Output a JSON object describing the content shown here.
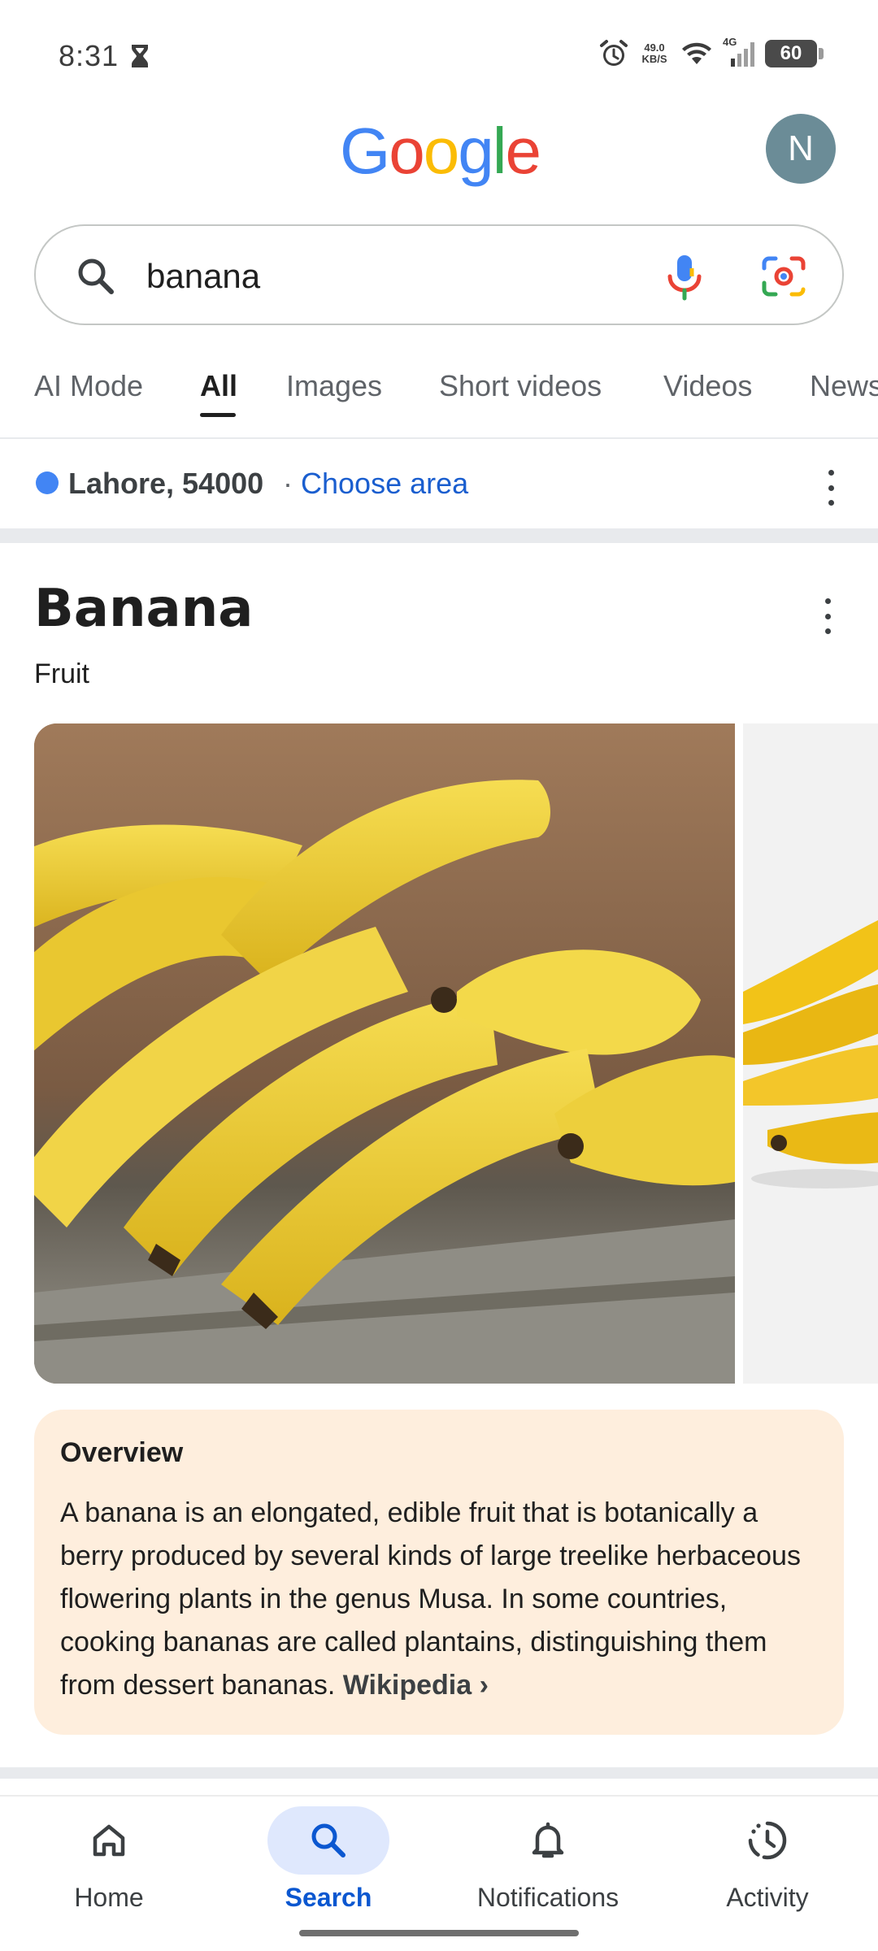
{
  "status_bar": {
    "time": "8:31",
    "net_speed_value": "49.0",
    "net_speed_unit": "KB/S",
    "cell_label": "4G",
    "battery": "60"
  },
  "header": {
    "logo_letters": [
      "G",
      "o",
      "o",
      "g",
      "l",
      "e"
    ],
    "logo_colors": [
      "#4285F4",
      "#EA4335",
      "#FBBC05",
      "#4285F4",
      "#34A853",
      "#EA4335"
    ],
    "avatar_initial": "N"
  },
  "search": {
    "query": "banana"
  },
  "tabs": [
    {
      "label": "AI Mode"
    },
    {
      "label": "All"
    },
    {
      "label": "Images"
    },
    {
      "label": "Short videos"
    },
    {
      "label": "Videos"
    },
    {
      "label": "News"
    }
  ],
  "active_tab": "All",
  "location": {
    "place": "Lahore, 54000",
    "separator": "·",
    "link": "Choose area"
  },
  "knowledge_panel": {
    "title": "Banana",
    "subtitle": "Fruit",
    "images": [
      {
        "icon": "bananas-photo"
      },
      {
        "icon": "bananas-photo-white-background"
      }
    ],
    "overview": {
      "heading": "Overview",
      "text": "A banana is an elongated, edible fruit that is botanically a berry produced by several kinds of large treelike herbaceous flowering plants in the genus Musa. In some countries, cooking bananas are called plantains, distinguishing them from dessert bananas.",
      "source": "Wikipedia",
      "source_chevron": "›"
    }
  },
  "bottom_nav": [
    {
      "label": "Home",
      "icon": "home-icon"
    },
    {
      "label": "Search",
      "icon": "search-icon"
    },
    {
      "label": "Notifications",
      "icon": "bell-icon"
    },
    {
      "label": "Activity",
      "icon": "activity-icon"
    }
  ],
  "colors": {
    "accent_blue": "#0B57D0",
    "link_blue": "#1A5ECF",
    "overview_bg": "#FEEEDD",
    "avatar_bg": "#6B8C97"
  }
}
